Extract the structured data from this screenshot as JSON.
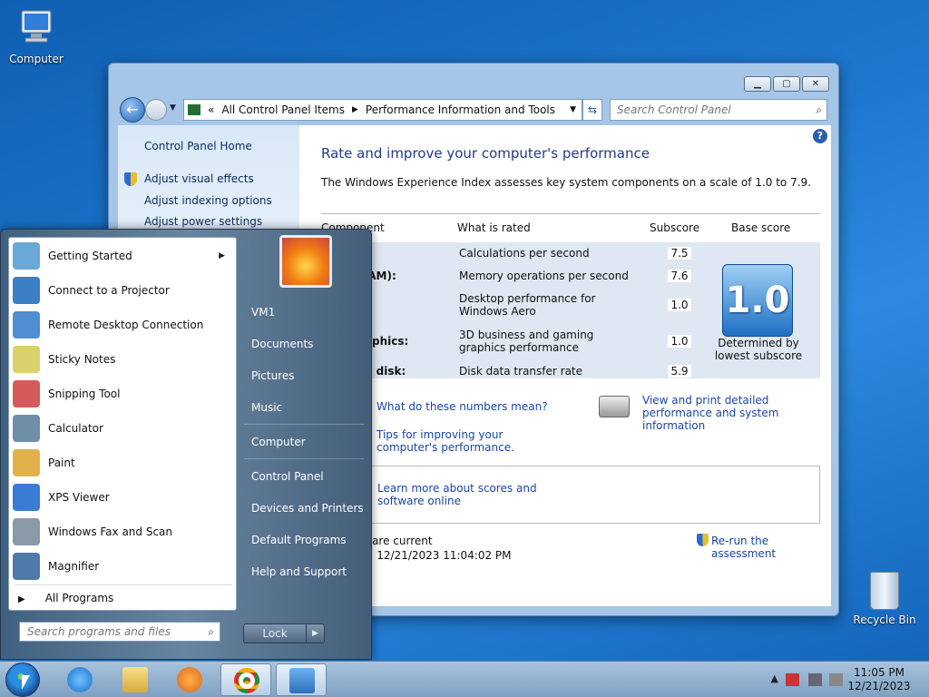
{
  "desktop": {
    "computer_label": "Computer",
    "recycle_label": "Recycle Bin"
  },
  "window": {
    "breadcrumb_prefix": "«",
    "breadcrumb_1": "All Control Panel Items",
    "breadcrumb_2": "Performance Information and Tools",
    "search_placeholder": "Search Control Panel",
    "left_links": {
      "home": "Control Panel Home",
      "visual": "Adjust visual effects",
      "indexing": "Adjust indexing options",
      "power": "Adjust power settings"
    },
    "title": "Rate and improve your computer's performance",
    "intro": "The Windows Experience Index assesses key system components on a scale of 1.0 to 7.9.",
    "headers": {
      "component": "Component",
      "what": "What is rated",
      "subscore": "Subscore",
      "base": "Base score"
    },
    "rows": [
      {
        "component": ":",
        "what": "Calculations per second",
        "sub": "7.5"
      },
      {
        "component": "RAM):",
        "what": "Memory operations per second",
        "sub": "7.6"
      },
      {
        "component": "",
        "what": "Desktop performance for Windows Aero",
        "sub": "1.0"
      },
      {
        "component": "raphics:",
        "what": "3D business and gaming graphics performance",
        "sub": "1.0"
      },
      {
        "component": "rd disk:",
        "what": "Disk data transfer rate",
        "sub": "5.9"
      }
    ],
    "base_score": "1.0",
    "base_caption": "Determined by lowest subscore",
    "links": {
      "numbers": "What do these numbers mean?",
      "tips": "Tips for improving your computer's performance.",
      "print": "View and print detailed performance and system information",
      "learn": "Learn more about scores and software online"
    },
    "status_1": "s are current",
    "status_2": "e: 12/21/2023 11:04:02 PM",
    "rerun": "Re-run the assessment"
  },
  "start_menu": {
    "programs": [
      {
        "label": "Getting Started",
        "color": "#6aa8d8",
        "has_arrow": true
      },
      {
        "label": "Connect to a Projector",
        "color": "#3c7fc4"
      },
      {
        "label": "Remote Desktop Connection",
        "color": "#4f8fcf"
      },
      {
        "label": "Sticky Notes",
        "color": "#d9d26b"
      },
      {
        "label": "Snipping Tool",
        "color": "#d55b5b"
      },
      {
        "label": "Calculator",
        "color": "#6f8fa8"
      },
      {
        "label": "Paint",
        "color": "#e2b14c"
      },
      {
        "label": "XPS Viewer",
        "color": "#3a7bd5"
      },
      {
        "label": "Windows Fax and Scan",
        "color": "#8a9aa8"
      },
      {
        "label": "Magnifier",
        "color": "#4d7aa8"
      }
    ],
    "all_programs": "All Programs",
    "search_placeholder": "Search programs and files",
    "right_links": {
      "user": "VM1",
      "documents": "Documents",
      "pictures": "Pictures",
      "music": "Music",
      "computer": "Computer",
      "control_panel": "Control Panel",
      "devices": "Devices and Printers",
      "defaults": "Default Programs",
      "help": "Help and Support"
    },
    "lock_label": "Lock"
  },
  "taskbar": {
    "time": "11:05 PM",
    "date": "12/21/2023",
    "tray_arrow": "▲"
  }
}
